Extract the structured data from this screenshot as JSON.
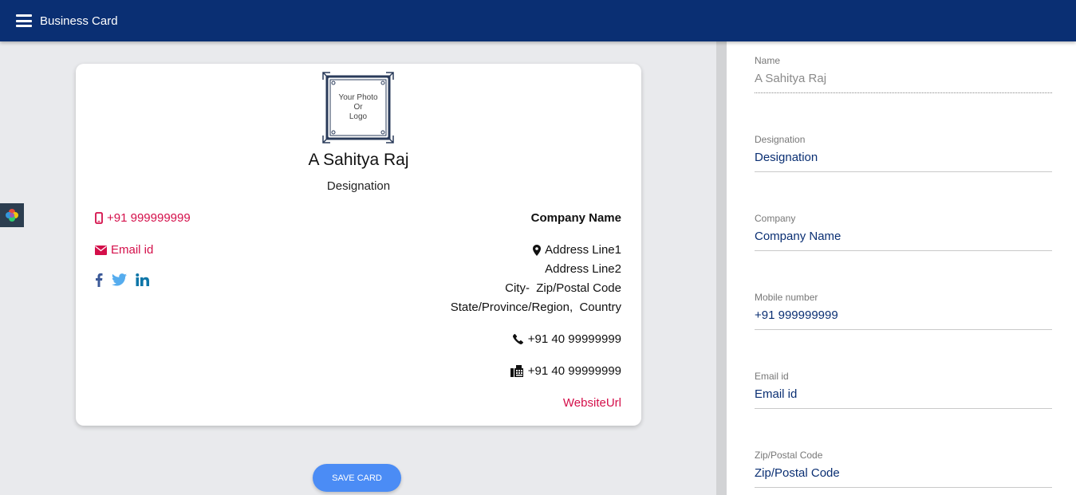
{
  "app": {
    "title": "Business Card"
  },
  "card": {
    "logo_lines": [
      "Your Photo",
      "Or",
      "Logo"
    ],
    "name": "A Sahitya Raj",
    "designation": "Designation",
    "mobile": "+91 999999999",
    "email": "Email id",
    "social_icons": [
      "facebook-icon",
      "twitter-icon",
      "linkedin-icon"
    ],
    "company": "Company Name",
    "address_line1": "Address Line1",
    "address_line2": "Address Line2",
    "city_zip": "City-  Zip/Postal Code",
    "state_country": "State/Province/Region,  Country",
    "phone": "+91 40 99999999",
    "fax": "+91 40 99999999",
    "website": "WebsiteUrl"
  },
  "save_button": "SAVE CARD",
  "form": {
    "fields": [
      {
        "label": "Name",
        "value": "A Sahitya Raj",
        "disabled": true
      },
      {
        "label": "Designation",
        "value": "Designation"
      },
      {
        "label": "Company",
        "value": "Company Name"
      },
      {
        "label": "Mobile number",
        "value": "+91 999999999"
      },
      {
        "label": "Email id",
        "value": "Email id"
      },
      {
        "label": "Zip/Postal Code",
        "value": "Zip/Postal Code"
      }
    ]
  },
  "colors": {
    "header": "#0a2f73",
    "accent_red": "#d40f4a",
    "button": "#4b8cf5",
    "facebook": "#3b5998",
    "twitter": "#55acee",
    "linkedin": "#0e76a8"
  }
}
